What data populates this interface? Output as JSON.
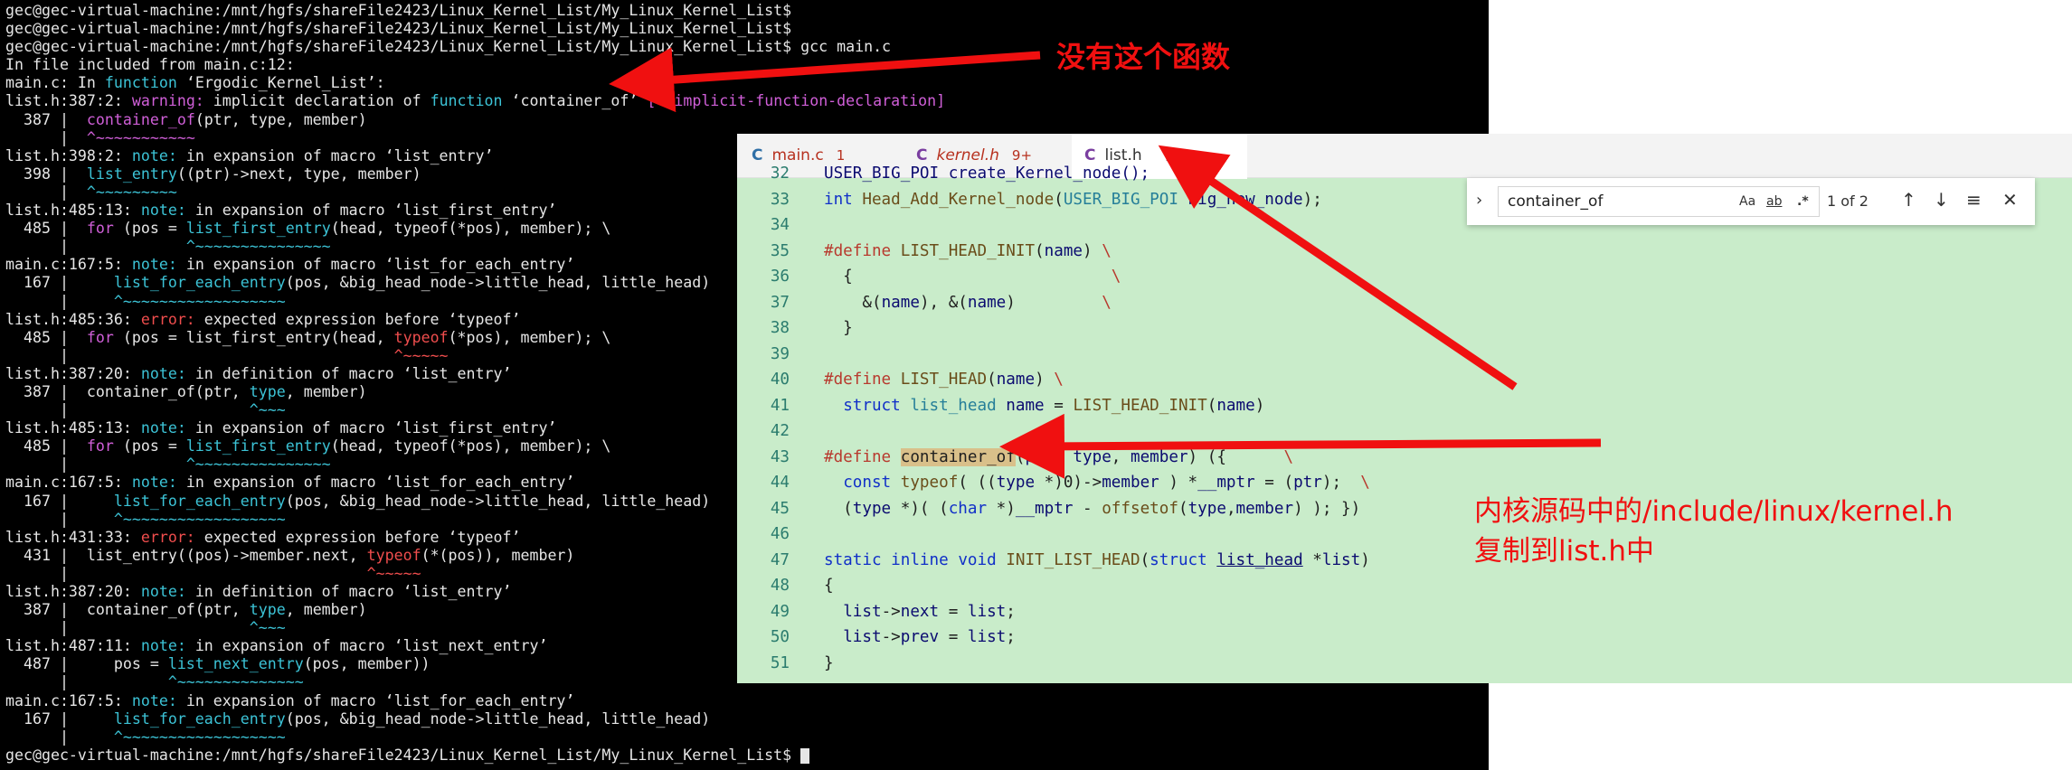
{
  "terminal": {
    "lines": [
      [
        [
          "white",
          "gec@gec-virtual-machine:/mnt/hgfs/shareFile2423/Linux_Kernel_List/My_Linux_Kernel_List$"
        ]
      ],
      [
        [
          "white",
          "gec@gec-virtual-machine:/mnt/hgfs/shareFile2423/Linux_Kernel_List/My_Linux_Kernel_List$"
        ]
      ],
      [
        [
          "white",
          "gec@gec-virtual-machine:/mnt/hgfs/shareFile2423/Linux_Kernel_List/My_Linux_Kernel_List$ gcc main.c"
        ]
      ],
      [
        [
          "white",
          "In file included from main.c:12:"
        ]
      ],
      [
        [
          "white",
          "main.c: In "
        ],
        [
          "cyan",
          "function"
        ],
        [
          "white",
          " ‘Ergodic_Kernel_List’:"
        ]
      ],
      [
        [
          "white",
          "list.h:387:2: "
        ],
        [
          "magenta",
          "warning: "
        ],
        [
          "white",
          "implicit declaration of "
        ],
        [
          "cyan",
          "function"
        ],
        [
          "white",
          " ‘container_of’ "
        ],
        [
          "magenta",
          "[-Wimplicit-function-declaration]"
        ]
      ],
      [
        [
          "white",
          "  387 |  "
        ],
        [
          "magenta",
          "container_of"
        ],
        [
          "white",
          "(ptr, type, member)"
        ]
      ],
      [
        [
          "white",
          "      |  "
        ],
        [
          "magenta",
          "^~~~~~~~~~~~"
        ]
      ],
      [
        [
          "white",
          "list.h:398:2: "
        ],
        [
          "cyan",
          "note: "
        ],
        [
          "white",
          "in expansion of macro ‘list_entry’"
        ]
      ],
      [
        [
          "white",
          "  398 |  "
        ],
        [
          "cyan",
          "list_entry"
        ],
        [
          "white",
          "((ptr)->next, type, member)"
        ]
      ],
      [
        [
          "white",
          "      |  "
        ],
        [
          "cyan",
          "^~~~~~~~~~"
        ]
      ],
      [
        [
          "white",
          "list.h:485:13: "
        ],
        [
          "cyan",
          "note: "
        ],
        [
          "white",
          "in expansion of macro ‘list_first_entry’"
        ]
      ],
      [
        [
          "white",
          "  485 |  "
        ],
        [
          "magenta",
          "for"
        ],
        [
          "white",
          " (pos = "
        ],
        [
          "cyan",
          "list_first_entry"
        ],
        [
          "white",
          "(head, typeof(*pos), member); \\"
        ]
      ],
      [
        [
          "white",
          "      |             "
        ],
        [
          "cyan",
          "^~~~~~~~~~~~~~~~"
        ]
      ],
      [
        [
          "white",
          "main.c:167:5: "
        ],
        [
          "cyan",
          "note: "
        ],
        [
          "white",
          "in expansion of macro ‘list_for_each_entry’"
        ]
      ],
      [
        [
          "white",
          "  167 |     "
        ],
        [
          "cyan",
          "list_for_each_entry"
        ],
        [
          "white",
          "(pos, &big_head_node->little_head, little_head)"
        ]
      ],
      [
        [
          "white",
          "      |     "
        ],
        [
          "cyan",
          "^~~~~~~~~~~~~~~~~~~"
        ]
      ],
      [
        [
          "white",
          "list.h:485:36: "
        ],
        [
          "red",
          "error: "
        ],
        [
          "white",
          "expected expression before ‘typeof’"
        ]
      ],
      [
        [
          "white",
          "  485 |  "
        ],
        [
          "magenta",
          "for"
        ],
        [
          "white",
          " (pos = list_first_entry(head, "
        ],
        [
          "red",
          "typeof"
        ],
        [
          "white",
          "(*pos), member); \\"
        ]
      ],
      [
        [
          "white",
          "      |                                    "
        ],
        [
          "red",
          "^~~~~~"
        ]
      ],
      [
        [
          "white",
          "list.h:387:20: "
        ],
        [
          "cyan",
          "note: "
        ],
        [
          "white",
          "in definition of macro ‘list_entry’"
        ]
      ],
      [
        [
          "white",
          "  387 |  container_of(ptr, "
        ],
        [
          "cyan",
          "type"
        ],
        [
          "white",
          ", member)"
        ]
      ],
      [
        [
          "white",
          "      |                    "
        ],
        [
          "cyan",
          "^~~~"
        ]
      ],
      [
        [
          "white",
          "list.h:485:13: "
        ],
        [
          "cyan",
          "note: "
        ],
        [
          "white",
          "in expansion of macro ‘list_first_entry’"
        ]
      ],
      [
        [
          "white",
          "  485 |  "
        ],
        [
          "magenta",
          "for"
        ],
        [
          "white",
          " (pos = "
        ],
        [
          "cyan",
          "list_first_entry"
        ],
        [
          "white",
          "(head, typeof(*pos), member); \\"
        ]
      ],
      [
        [
          "white",
          "      |             "
        ],
        [
          "cyan",
          "^~~~~~~~~~~~~~~~"
        ]
      ],
      [
        [
          "white",
          "main.c:167:5: "
        ],
        [
          "cyan",
          "note: "
        ],
        [
          "white",
          "in expansion of macro ‘list_for_each_entry’"
        ]
      ],
      [
        [
          "white",
          "  167 |     "
        ],
        [
          "cyan",
          "list_for_each_entry"
        ],
        [
          "white",
          "(pos, &big_head_node->little_head, little_head)"
        ]
      ],
      [
        [
          "white",
          "      |     "
        ],
        [
          "cyan",
          "^~~~~~~~~~~~~~~~~~~"
        ]
      ],
      [
        [
          "white",
          "list.h:431:33: "
        ],
        [
          "red",
          "error: "
        ],
        [
          "white",
          "expected expression before ‘typeof’"
        ]
      ],
      [
        [
          "white",
          "  431 |  list_entry((pos)->member.next, "
        ],
        [
          "red",
          "typeof"
        ],
        [
          "white",
          "(*(pos)), member)"
        ]
      ],
      [
        [
          "white",
          "      |                                 "
        ],
        [
          "red",
          "^~~~~~"
        ]
      ],
      [
        [
          "white",
          "list.h:387:20: "
        ],
        [
          "cyan",
          "note: "
        ],
        [
          "white",
          "in definition of macro ‘list_entry’"
        ]
      ],
      [
        [
          "white",
          "  387 |  container_of(ptr, "
        ],
        [
          "cyan",
          "type"
        ],
        [
          "white",
          ", member)"
        ]
      ],
      [
        [
          "white",
          "      |                    "
        ],
        [
          "cyan",
          "^~~~"
        ]
      ],
      [
        [
          "white",
          "list.h:487:11: "
        ],
        [
          "cyan",
          "note: "
        ],
        [
          "white",
          "in expansion of macro ‘list_next_entry’"
        ]
      ],
      [
        [
          "white",
          "  487 |     pos = "
        ],
        [
          "cyan",
          "list_next_entry"
        ],
        [
          "white",
          "(pos, member))"
        ]
      ],
      [
        [
          "white",
          "      |           "
        ],
        [
          "cyan",
          "^~~~~~~~~~~~~~~"
        ]
      ],
      [
        [
          "white",
          "main.c:167:5: "
        ],
        [
          "cyan",
          "note: "
        ],
        [
          "white",
          "in expansion of macro ‘list_for_each_entry’"
        ]
      ],
      [
        [
          "white",
          "  167 |     "
        ],
        [
          "cyan",
          "list_for_each_entry"
        ],
        [
          "white",
          "(pos, &big_head_node->little_head, little_head)"
        ]
      ],
      [
        [
          "white",
          "      |     "
        ],
        [
          "cyan",
          "^~~~~~~~~~~~~~~~~~~"
        ]
      ],
      [
        [
          "white",
          "gec@gec-virtual-machine:/mnt/hgfs/shareFile2423/Linux_Kernel_List/My_Linux_Kernel_List$ "
        ]
      ]
    ]
  },
  "editor": {
    "tabs": [
      {
        "icon": "C",
        "label": "main.c",
        "badge": "1",
        "active": false
      },
      {
        "icon": "C",
        "label": "kernel.h",
        "badge": "9+",
        "active": false
      },
      {
        "icon": "C",
        "label": "list.h",
        "badge": "",
        "active": true,
        "close": "×"
      }
    ],
    "code": [
      {
        "n": "32",
        "t": [
          [
            "var",
            "USER_BIG_POI create_Kernel_node();"
          ]
        ]
      },
      {
        "n": "33",
        "t": [
          [
            "kw",
            "int"
          ],
          [
            "txt",
            " "
          ],
          [
            "fn",
            "Head_Add_Kernel_node"
          ],
          [
            "txt",
            "("
          ],
          [
            "ty",
            "USER_BIG_POI"
          ],
          [
            "txt",
            " "
          ],
          [
            "var",
            "big_new_node"
          ],
          [
            "txt",
            ");"
          ]
        ]
      },
      {
        "n": "34",
        "t": []
      },
      {
        "n": "35",
        "t": [
          [
            "mac",
            "#define"
          ],
          [
            "txt",
            " "
          ],
          [
            "fn",
            "LIST_HEAD_INIT"
          ],
          [
            "txt",
            "("
          ],
          [
            "var",
            "name"
          ],
          [
            "txt",
            ") "
          ],
          [
            "mac",
            "\\"
          ]
        ]
      },
      {
        "n": "36",
        "t": [
          [
            "txt",
            "  {                           "
          ],
          [
            "mac",
            "\\"
          ]
        ]
      },
      {
        "n": "37",
        "t": [
          [
            "txt",
            "    &("
          ],
          [
            "var",
            "name"
          ],
          [
            "txt",
            "), &("
          ],
          [
            "var",
            "name"
          ],
          [
            "txt",
            ")         "
          ],
          [
            "mac",
            "\\"
          ]
        ]
      },
      {
        "n": "38",
        "t": [
          [
            "txt",
            "  }"
          ]
        ]
      },
      {
        "n": "39",
        "t": []
      },
      {
        "n": "40",
        "t": [
          [
            "mac",
            "#define"
          ],
          [
            "txt",
            " "
          ],
          [
            "fn",
            "LIST_HEAD"
          ],
          [
            "txt",
            "("
          ],
          [
            "var",
            "name"
          ],
          [
            "txt",
            ") "
          ],
          [
            "mac",
            "\\"
          ]
        ]
      },
      {
        "n": "41",
        "t": [
          [
            "txt",
            "  "
          ],
          [
            "kw",
            "struct"
          ],
          [
            "txt",
            " "
          ],
          [
            "ty",
            "list_head"
          ],
          [
            "txt",
            " "
          ],
          [
            "var",
            "name"
          ],
          [
            "txt",
            " = "
          ],
          [
            "fn",
            "LIST_HEAD_INIT"
          ],
          [
            "txt",
            "("
          ],
          [
            "var",
            "name"
          ],
          [
            "txt",
            ")"
          ]
        ]
      },
      {
        "n": "42",
        "t": []
      },
      {
        "n": "43",
        "t": [
          [
            "mac",
            "#define"
          ],
          [
            "txt",
            " "
          ],
          [
            "hl",
            "container_of"
          ],
          [
            "txt",
            "("
          ],
          [
            "var",
            "ptr"
          ],
          [
            "txt",
            ", "
          ],
          [
            "var",
            "type"
          ],
          [
            "txt",
            ", "
          ],
          [
            "var",
            "member"
          ],
          [
            "txt",
            ") ({      "
          ],
          [
            "mac",
            "\\"
          ]
        ]
      },
      {
        "n": "44",
        "t": [
          [
            "txt",
            "  "
          ],
          [
            "kw",
            "const"
          ],
          [
            "txt",
            " "
          ],
          [
            "fn",
            "typeof"
          ],
          [
            "txt",
            "( (("
          ],
          [
            "var",
            "type"
          ],
          [
            "txt",
            " *)0)->"
          ],
          [
            "var",
            "member"
          ],
          [
            "txt",
            " ) *"
          ],
          [
            "var",
            "__mptr"
          ],
          [
            "txt",
            " = ("
          ],
          [
            "var",
            "ptr"
          ],
          [
            "txt",
            ");  "
          ],
          [
            "mac",
            "\\"
          ]
        ]
      },
      {
        "n": "45",
        "t": [
          [
            "txt",
            "  ("
          ],
          [
            "var",
            "type"
          ],
          [
            "txt",
            " *)( ("
          ],
          [
            "kw",
            "char"
          ],
          [
            "txt",
            " *)"
          ],
          [
            "var",
            "__mptr"
          ],
          [
            "txt",
            " - "
          ],
          [
            "fn",
            "offsetof"
          ],
          [
            "txt",
            "("
          ],
          [
            "var",
            "type"
          ],
          [
            "txt",
            ","
          ],
          [
            "var",
            "member"
          ],
          [
            "txt",
            ") ); })"
          ]
        ]
      },
      {
        "n": "46",
        "t": []
      },
      {
        "n": "47",
        "t": [
          [
            "kw",
            "static"
          ],
          [
            "txt",
            " "
          ],
          [
            "kw",
            "inline"
          ],
          [
            "txt",
            " "
          ],
          [
            "kw",
            "void"
          ],
          [
            "txt",
            " "
          ],
          [
            "fn",
            "INIT_LIST_HEAD"
          ],
          [
            "txt",
            "("
          ],
          [
            "kw",
            "struct"
          ],
          [
            "txt",
            " "
          ],
          [
            "ul",
            "list_head"
          ],
          [
            "txt",
            " *"
          ],
          [
            "var",
            "list"
          ],
          [
            "txt",
            ")"
          ]
        ]
      },
      {
        "n": "48",
        "t": [
          [
            "txt",
            "{"
          ]
        ]
      },
      {
        "n": "49",
        "t": [
          [
            "txt",
            "  "
          ],
          [
            "var",
            "list"
          ],
          [
            "txt",
            "->"
          ],
          [
            "var",
            "next"
          ],
          [
            "txt",
            " = "
          ],
          [
            "var",
            "list"
          ],
          [
            "txt",
            ";"
          ]
        ]
      },
      {
        "n": "50",
        "t": [
          [
            "txt",
            "  "
          ],
          [
            "var",
            "list"
          ],
          [
            "txt",
            "->"
          ],
          [
            "var",
            "prev"
          ],
          [
            "txt",
            " = "
          ],
          [
            "var",
            "list"
          ],
          [
            "txt",
            ";"
          ]
        ]
      },
      {
        "n": "51",
        "t": [
          [
            "txt",
            "}"
          ]
        ]
      }
    ]
  },
  "find": {
    "value": "container_of",
    "opt_case": "Aa",
    "opt_word": "ab",
    "opt_regex": ".*",
    "count": "1 of 2"
  },
  "annotations": {
    "top": "没有这个函数",
    "right_line1": "内核源码中的/include/linux/kernel.h",
    "right_line2": "复制到list.h中"
  }
}
